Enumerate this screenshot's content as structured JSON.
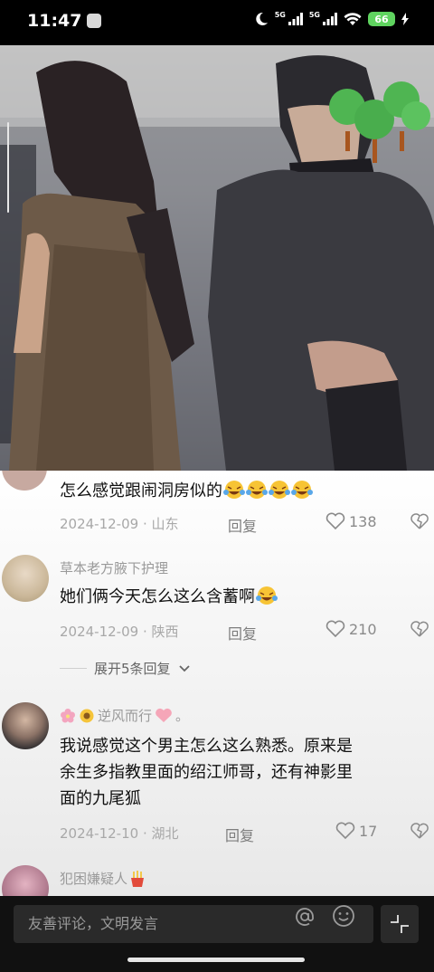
{
  "status_bar": {
    "time": "11:47",
    "network_1": "5G",
    "network_2": "5G",
    "battery": "66",
    "icons": [
      "moon-icon",
      "signal-icon",
      "wifi-icon",
      "battery-icon",
      "charging-icon"
    ]
  },
  "video": {
    "description_icons": [
      "tree-sticker-icon"
    ]
  },
  "comments": [
    {
      "text": "怎么感觉跟闹洞房似的",
      "emoji_count": 4,
      "emoji": "laughing-tears-emoji",
      "date": "2024-12-09",
      "location": "山东",
      "reply_label": "回复",
      "likes": "138"
    },
    {
      "user": "草本老方腋下护理",
      "text": "她们俩今天怎么这么含蓄啊",
      "emoji_count": 1,
      "emoji": "laughing-tears-emoji",
      "date": "2024-12-09",
      "location": "陕西",
      "reply_label": "回复",
      "likes": "210"
    },
    {
      "user": "逆风而行",
      "user_icons": [
        "cherry-blossom-icon",
        "sunflower-icon",
        "heart-icon"
      ],
      "user_suffix": "。",
      "text_lines": [
        "我说感觉这个男主怎么这么熟悉。原来是",
        "余生多指教里面的绍江师哥，还有神影里",
        "面的九尾狐"
      ],
      "date": "2024-12-10",
      "location": "湖北",
      "reply_label": "回复",
      "likes": "17"
    },
    {
      "user": "犯困嫌疑人",
      "user_icons": [
        "fries-icon"
      ]
    }
  ],
  "expand_replies": "展开5条回复",
  "meta_separator": "·",
  "input_bar": {
    "placeholder": "友善评论，文明发言",
    "icons": [
      "at-icon",
      "smile-icon",
      "collapse-icon"
    ]
  },
  "colors": {
    "background": "#000000",
    "comment_text": "#111111",
    "meta_text": "#a8a8a8",
    "input_bg": "#2a2a2a",
    "battery": "#5fd35f"
  }
}
